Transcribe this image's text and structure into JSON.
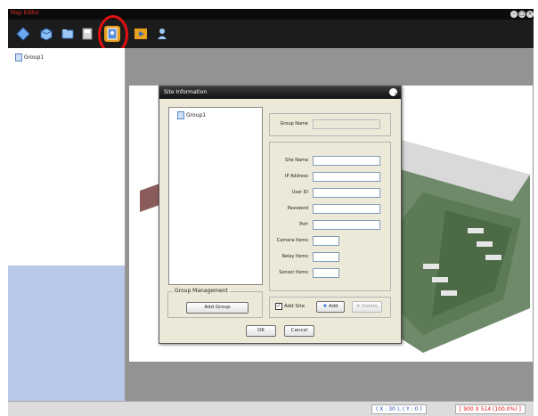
{
  "app": {
    "title": "Map Editor"
  },
  "window_controls": {
    "min": "–",
    "max": "□",
    "close": "×"
  },
  "toolbar": {
    "buttons": [
      {
        "icon": "diamond-icon"
      },
      {
        "icon": "cube-icon"
      },
      {
        "icon": "folder-icon"
      },
      {
        "icon": "save-icon"
      },
      {
        "icon": "site-info-icon",
        "selected": true
      },
      {
        "icon": "play-icon"
      },
      {
        "icon": "person-icon"
      }
    ]
  },
  "sidebar": {
    "tree_root": "Group1"
  },
  "dialog": {
    "title": "Site Information",
    "tree_root": "Group1",
    "group_management_legend": "Group Management",
    "add_group": "Add Group",
    "group_name_label": "Group Name",
    "fields": {
      "site_name": "Site Name",
      "ip_address": "IP Address",
      "user_id": "User ID",
      "password": "Password",
      "port": "Port",
      "camera_items": "Camera Items",
      "relay_items": "Relay Items",
      "sensor_items": "Sensor Items"
    },
    "add_site_label": "Add Site",
    "add_site_checked": true,
    "add_button": "Add",
    "delete_button": "Delete",
    "ok_button": "OK",
    "cancel_button": "Cancel"
  },
  "status": {
    "coords": "( X : 30 ), ( Y : 0 )",
    "size": "[ 900 X 514 (100.0%) ]"
  },
  "colors": {
    "accent_red": "#e01010",
    "preview_blue": "#b9c7e8",
    "canvas_gray": "#939393"
  }
}
